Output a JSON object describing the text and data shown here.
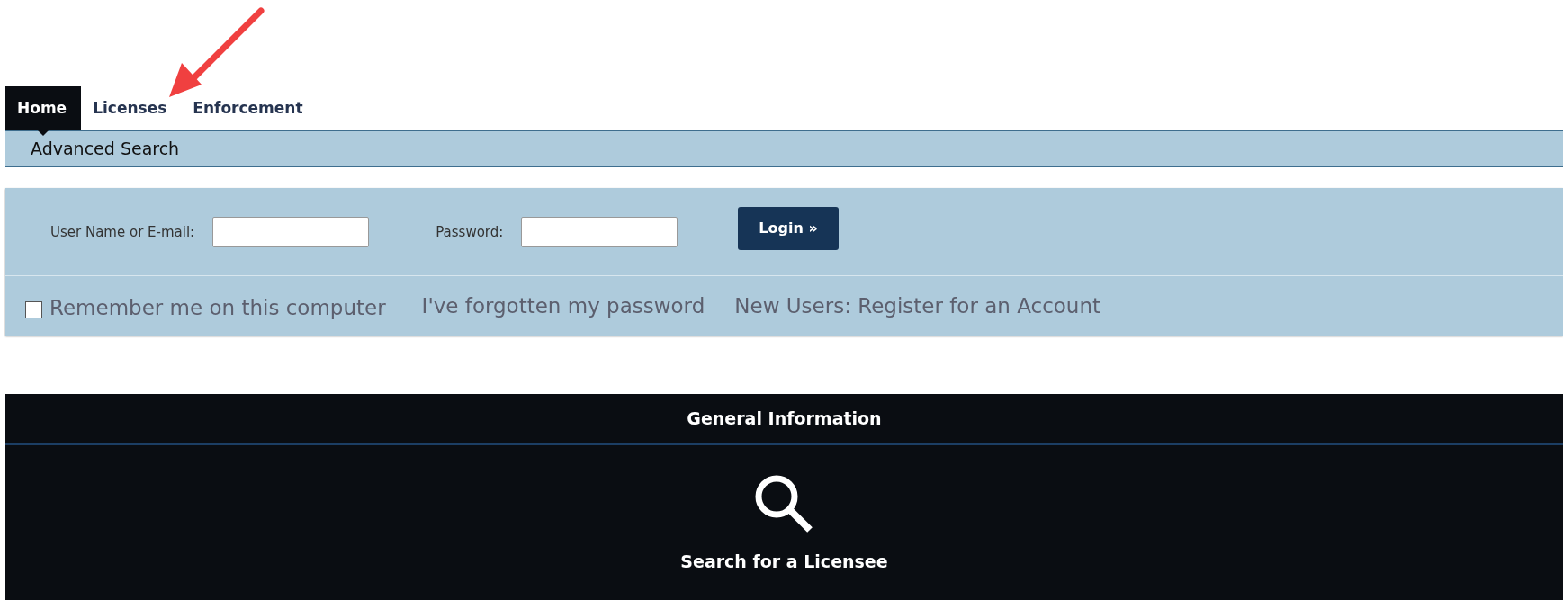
{
  "tabs": [
    {
      "label": "Home",
      "selected": true
    },
    {
      "label": "Licenses",
      "selected": false
    },
    {
      "label": "Enforcement",
      "selected": false
    }
  ],
  "subnav": {
    "items": [
      "Advanced Search"
    ]
  },
  "login": {
    "username_label": "User Name or E-mail:",
    "password_label": "Password:",
    "button": "Login »",
    "remember": {
      "label": "Remember me on this computer",
      "checked": false
    },
    "links": [
      "I've forgotten my password",
      "New Users: Register for an Account"
    ]
  },
  "general_information": {
    "title": "General Information",
    "items": [
      {
        "label": "Search for a Licensee"
      }
    ]
  }
}
